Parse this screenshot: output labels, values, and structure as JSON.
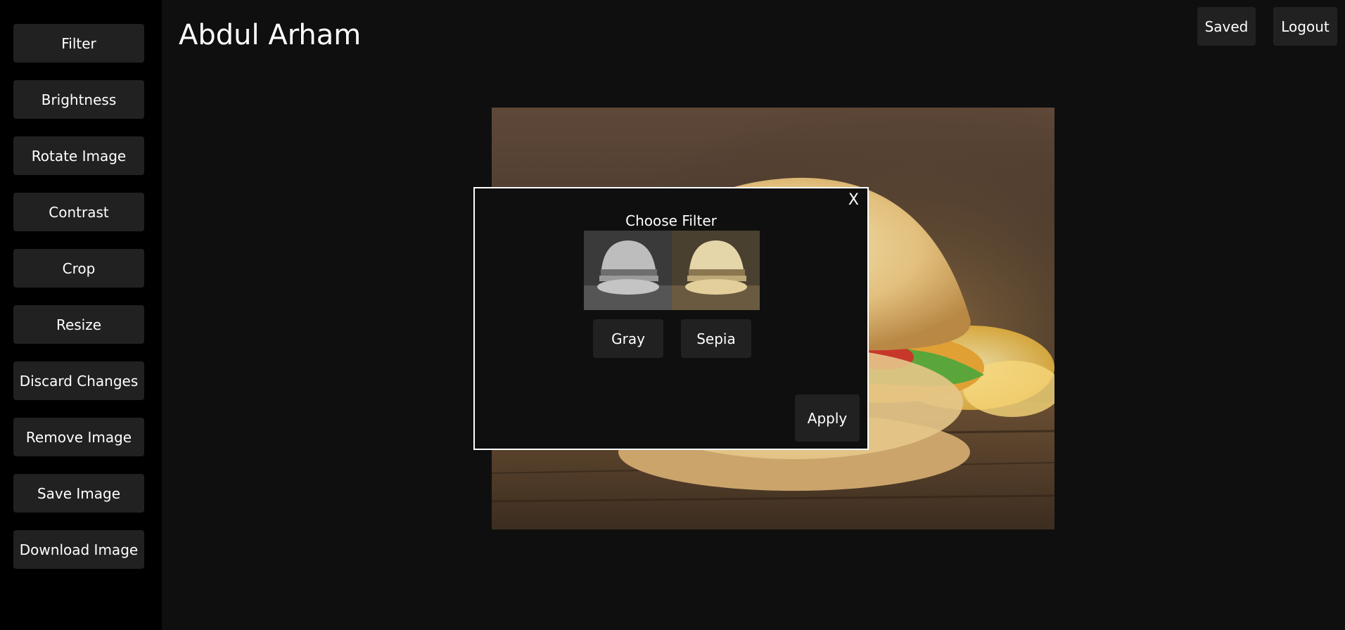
{
  "header": {
    "title": "Abdul Arham",
    "saved_label": "Saved",
    "logout_label": "Logout"
  },
  "sidebar": {
    "items": [
      {
        "label": "Filter"
      },
      {
        "label": "Brightness"
      },
      {
        "label": "Rotate Image"
      },
      {
        "label": "Contrast"
      },
      {
        "label": "Crop"
      },
      {
        "label": "Resize"
      },
      {
        "label": "Discard Changes"
      },
      {
        "label": "Remove Image"
      },
      {
        "label": "Save Image"
      },
      {
        "label": "Download Image"
      }
    ]
  },
  "modal": {
    "close_label": "X",
    "title": "Choose Filter",
    "filters": [
      {
        "label": "Gray"
      },
      {
        "label": "Sepia"
      }
    ],
    "apply_label": "Apply"
  },
  "colors": {
    "page_bg": "#0f0f0f",
    "sidebar_bg": "#000000",
    "button_bg": "#212121",
    "text": "#ffffff"
  }
}
